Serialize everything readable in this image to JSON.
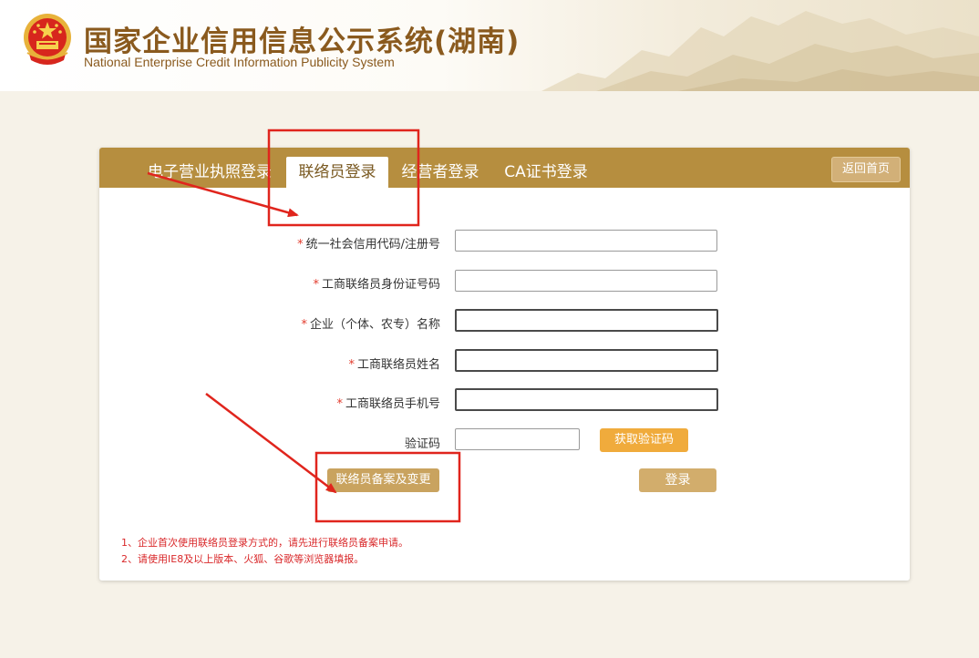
{
  "header": {
    "title": "国家企业信用信息公示系统(湖南)",
    "subtitle": "National Enterprise Credit Information Publicity System"
  },
  "tabs": [
    {
      "label": "电子营业执照登录",
      "active": false
    },
    {
      "label": "联络员登录",
      "active": true
    },
    {
      "label": "经营者登录",
      "active": false
    },
    {
      "label": "CA证书登录",
      "active": false
    }
  ],
  "home_button": "返回首页",
  "form": {
    "required_mark": "*",
    "fields": [
      {
        "label": "统一社会信用代码/注册号",
        "required": true,
        "value": ""
      },
      {
        "label": "工商联络员身份证号码",
        "required": true,
        "value": ""
      },
      {
        "label": "企业（个体、农专）名称",
        "required": true,
        "value": ""
      },
      {
        "label": "工商联络员姓名",
        "required": true,
        "value": ""
      },
      {
        "label": "工商联络员手机号",
        "required": true,
        "value": ""
      },
      {
        "label": "验证码",
        "required": false,
        "value": ""
      }
    ],
    "get_code_button": "获取验证码",
    "register_button": "联络员备案及变更",
    "login_button": "登录"
  },
  "notes": [
    "1、企业首次使用联络员登录方式的，请先进行联络员备案申请。",
    "2、请使用IE8及以上版本、火狐、谷歌等浏览器填报。"
  ],
  "colors": {
    "brand_gold": "#b68e3f",
    "title_brown": "#8a5a1e",
    "annotation_red": "#e0251d",
    "sms_orange": "#f0ab3c"
  }
}
